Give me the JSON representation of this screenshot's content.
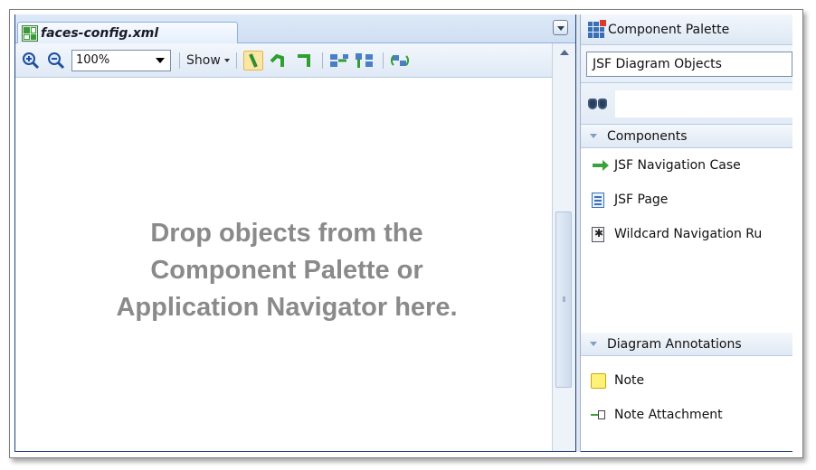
{
  "editor": {
    "tab_title": "faces-config.xml",
    "toolbar": {
      "zoom_value": "100%",
      "show_label": "Show"
    },
    "drop_message": [
      "Drop objects from the",
      "Component Palette or",
      "Application Navigator here."
    ]
  },
  "palette": {
    "title": "Component Palette",
    "library": "JSF Diagram Objects",
    "sections": [
      {
        "label": "Components",
        "items": [
          {
            "label": "JSF Navigation Case",
            "icon": "green-arrow-icon"
          },
          {
            "label": "JSF Page",
            "icon": "page-icon"
          },
          {
            "label": "Wildcard Navigation Ru",
            "icon": "wildcard-icon"
          }
        ]
      },
      {
        "label": "Diagram Annotations",
        "items": [
          {
            "label": "Note",
            "icon": "note-icon"
          },
          {
            "label": "Note Attachment",
            "icon": "attachment-icon"
          }
        ]
      }
    ]
  },
  "colors": {
    "border": "#1f3f7f",
    "toolbar_bg": "#dfe9f5",
    "message_text": "#8a8a8a",
    "active_tool": "#fbe6a6"
  }
}
